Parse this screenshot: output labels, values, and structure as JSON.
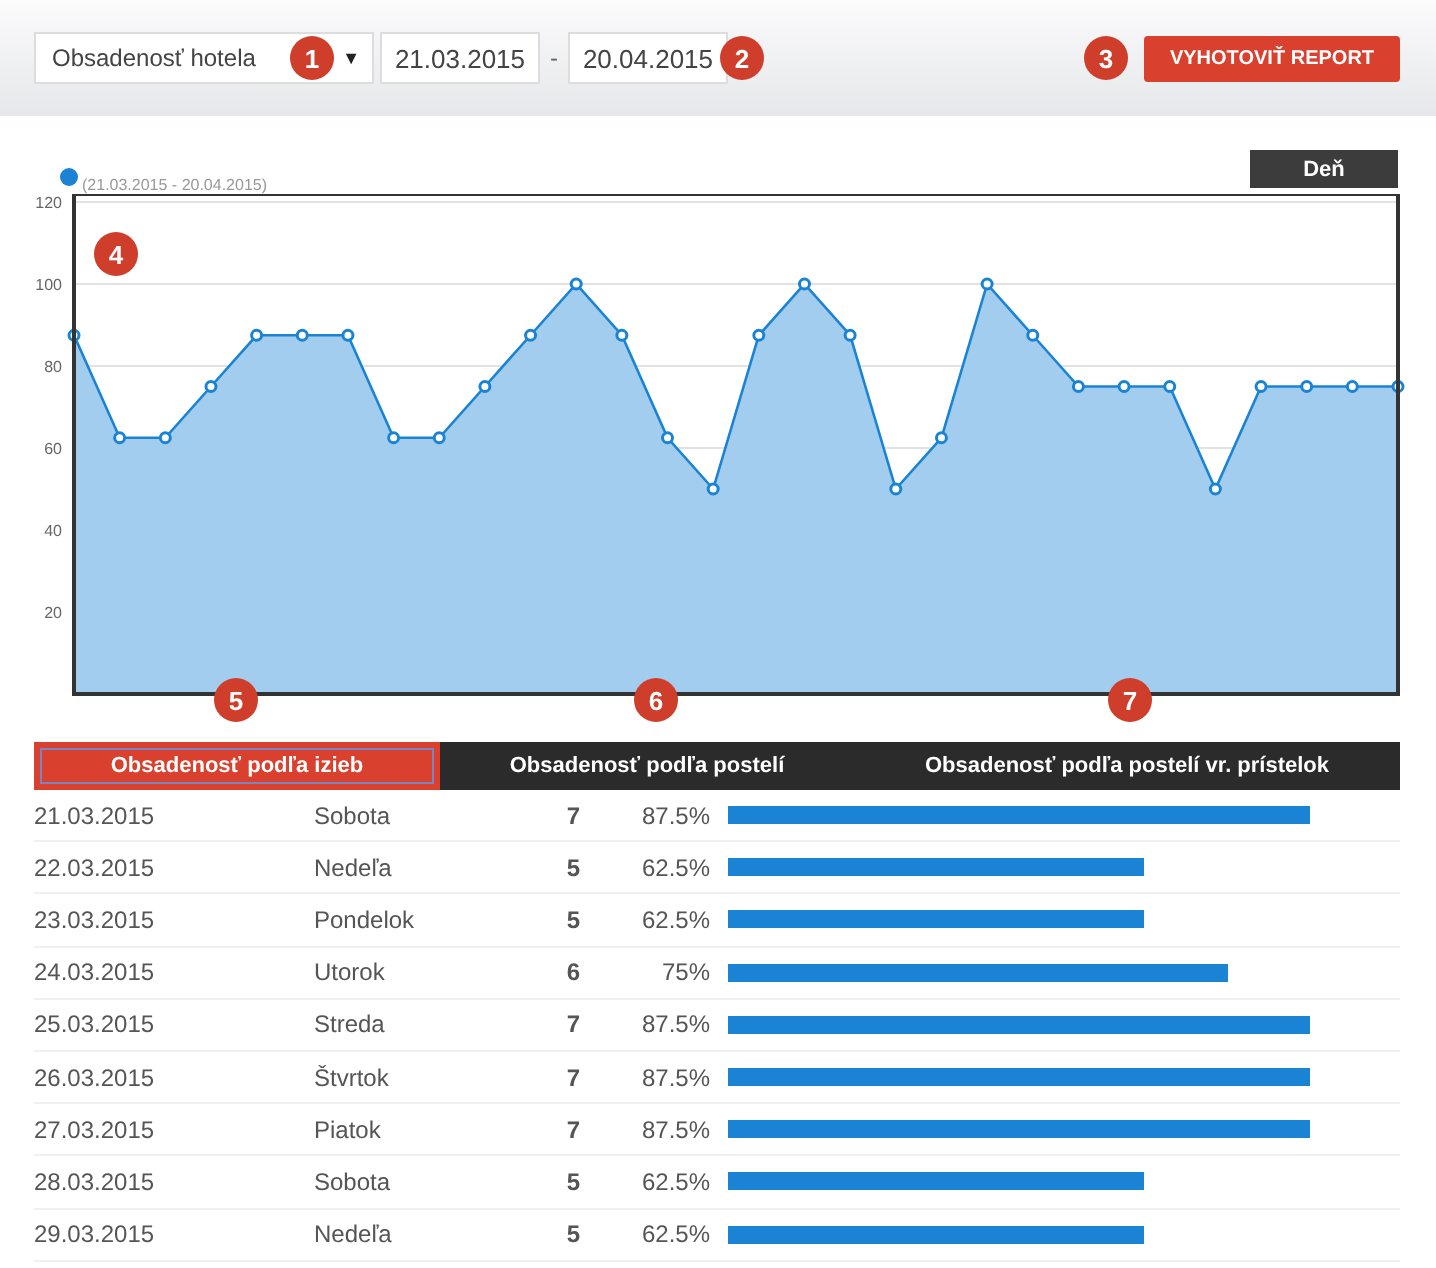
{
  "toolbar": {
    "report_select": {
      "value": "Obsadenosť hotela",
      "arrow": "▼"
    },
    "date_from": "21.03.2015",
    "separator": "-",
    "date_to": "20.04.2015",
    "report_button": "VYHOTOVIŤ REPORT"
  },
  "chart": {
    "period_button": "Deň",
    "chart_data": {
      "type": "area",
      "series": [
        {
          "name": "(21.03.2015 - 20.04.2015)",
          "color": "#1a83d4",
          "values": [
            87.5,
            62.5,
            62.5,
            75,
            87.5,
            87.5,
            87.5,
            62.5,
            62.5,
            75,
            87.5,
            100,
            87.5,
            62.5,
            50,
            87.5,
            100,
            87.5,
            50,
            62.5,
            100,
            87.5,
            75,
            75,
            75,
            50,
            75,
            75,
            75,
            75
          ]
        }
      ],
      "ylim": [
        0,
        120
      ],
      "grid": true,
      "yticks": [
        20,
        40,
        60,
        80,
        100,
        120
      ]
    }
  },
  "table": {
    "tabs": [
      {
        "label": "Obsadenosť podľa izieb",
        "selected": true
      },
      {
        "label": "Obsadenosť podľa postelí",
        "selected": false
      },
      {
        "label": "Obsadenosť podľa postelí vr. prístelok",
        "selected": false
      }
    ],
    "rows": [
      {
        "date": "21.03.2015",
        "day": "Sobota",
        "count": "7",
        "percent": "87.5%",
        "level": 0.875
      },
      {
        "date": "22.03.2015",
        "day": "Nedeľa",
        "count": "5",
        "percent": "62.5%",
        "level": 0.625
      },
      {
        "date": "23.03.2015",
        "day": "Pondelok",
        "count": "5",
        "percent": "62.5%",
        "level": 0.625
      },
      {
        "date": "24.03.2015",
        "day": "Utorok",
        "count": "6",
        "percent": "75%",
        "level": 0.75
      },
      {
        "date": "25.03.2015",
        "day": "Streda",
        "count": "7",
        "percent": "87.5%",
        "level": 0.875
      },
      {
        "date": "26.03.2015",
        "day": "Štvrtok",
        "count": "7",
        "percent": "87.5%",
        "level": 0.875
      },
      {
        "date": "27.03.2015",
        "day": "Piatok",
        "count": "7",
        "percent": "87.5%",
        "level": 0.875
      },
      {
        "date": "28.03.2015",
        "day": "Sobota",
        "count": "5",
        "percent": "62.5%",
        "level": 0.625
      },
      {
        "date": "29.03.2015",
        "day": "Nedeľa",
        "count": "5",
        "percent": "62.5%",
        "level": 0.625
      }
    ]
  },
  "callouts": [
    "1",
    "2",
    "3",
    "4",
    "5",
    "6",
    "7"
  ]
}
